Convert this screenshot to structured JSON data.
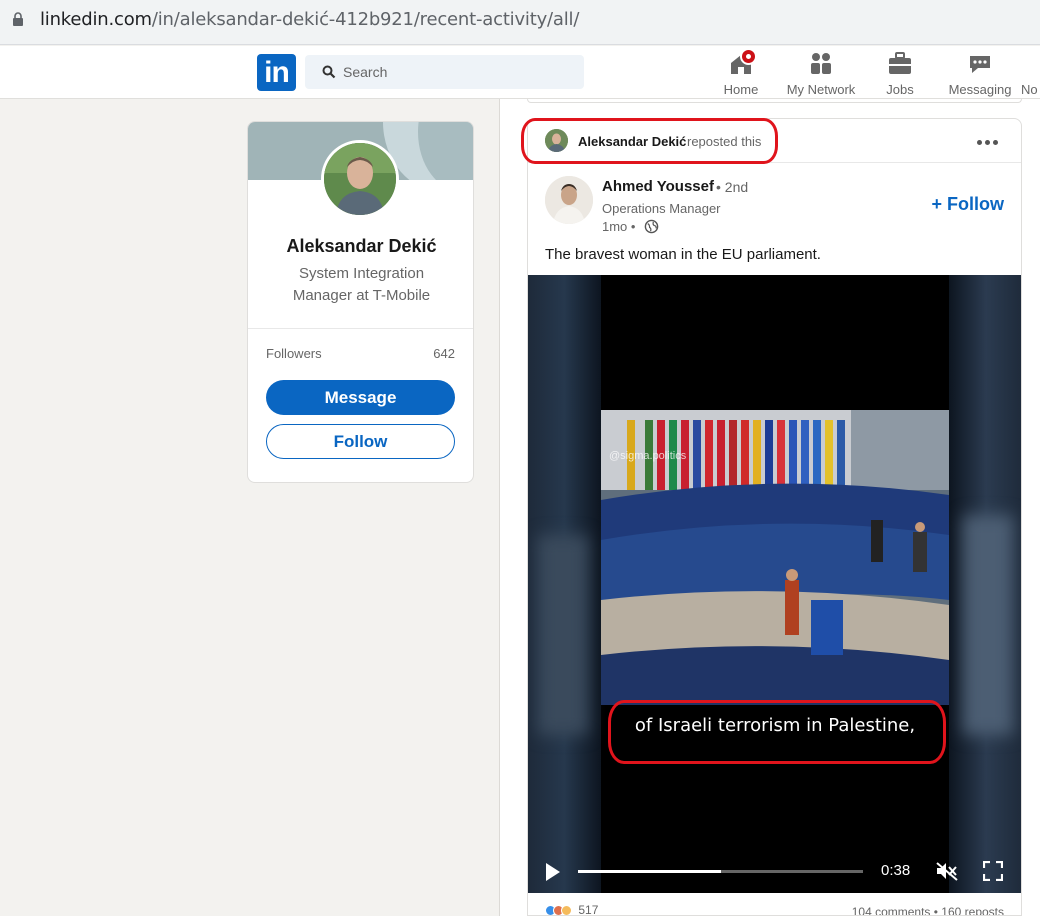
{
  "browser": {
    "url_host": "linkedin.com",
    "url_path": "/in/aleksandar-dekić-412b921/recent-activity/all/"
  },
  "nav": {
    "logo": "in",
    "search_placeholder": "Search",
    "items": [
      {
        "label": "Home",
        "icon": "home-icon"
      },
      {
        "label": "My Network",
        "icon": "network-icon"
      },
      {
        "label": "Jobs",
        "icon": "briefcase-icon"
      },
      {
        "label": "Messaging",
        "icon": "chat-icon"
      },
      {
        "label": "No",
        "icon": "bell-icon"
      }
    ]
  },
  "profile": {
    "name": "Aleksandar Dekić",
    "headline": "System Integration Manager at T-Mobile",
    "followers_label": "Followers",
    "followers_count": "642",
    "message_button": "Message",
    "follow_button": "Follow"
  },
  "post": {
    "reposter": "Aleksandar Dekić",
    "repost_text": "reposted this",
    "author": "Ahmed Youssef",
    "degree": "• 2nd",
    "author_title": "Operations Manager",
    "time": "1mo •",
    "follow_label": "+ Follow",
    "text": "The bravest woman in the EU parliament.",
    "video": {
      "watermark": "@sigma.politics",
      "subtitle": "of Israeli terrorism in Palestine,",
      "time": "0:38",
      "progress": 0.5
    },
    "reactions_count": "517",
    "comments_reposts": "104 comments • 160 reposts"
  },
  "colors": {
    "linkedin_blue": "#0a66c2",
    "annotation_red": "#e0141c",
    "page_bg": "#f3f2ef"
  }
}
